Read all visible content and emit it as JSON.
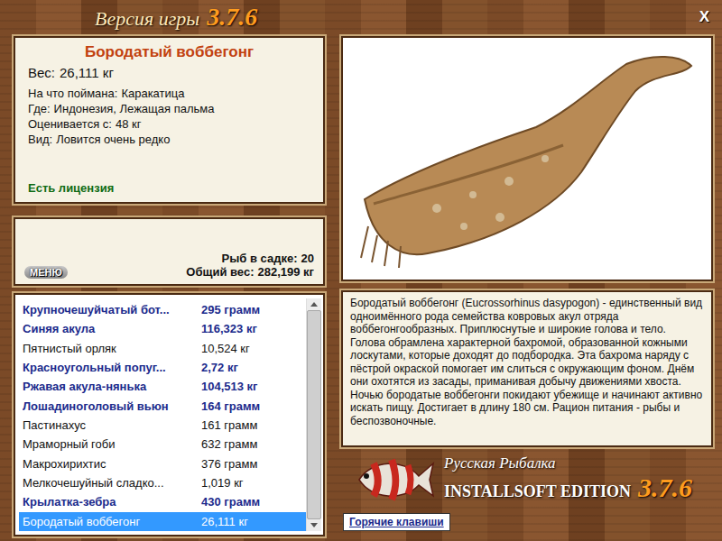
{
  "window": {
    "title": "Версия игры",
    "version": "3.7.6",
    "close": "X"
  },
  "fish_card": {
    "name": "Бородатый воббегонг",
    "weight_label": "Вес:",
    "weight": "26,111 кг",
    "details": [
      {
        "label": "На что поймана:",
        "value": "Каракатица"
      },
      {
        "label": "Где:",
        "value": "Индонезия, Лежащая пальма"
      },
      {
        "label": "Оценивается с:",
        "value": "48 кг"
      },
      {
        "label": "Вид:",
        "value": "Ловится очень редко"
      }
    ],
    "license": "Есть лицензия"
  },
  "keepnet": {
    "menu_button": "МЕНЮ",
    "count_label": "Рыб в садке:",
    "count": "20",
    "total_label": "Общий вес:",
    "total": "282,199 кг"
  },
  "catch_list": {
    "rows": [
      {
        "name": "Крупночешуйчатый бот...",
        "weight": "295 грамм",
        "highlighted": true,
        "selected": false
      },
      {
        "name": "Синяя акула",
        "weight": "116,323 кг",
        "highlighted": true,
        "selected": false
      },
      {
        "name": "Пятнистый орляк",
        "weight": "10,524 кг",
        "highlighted": false,
        "selected": false
      },
      {
        "name": "Красноугольный попуг...",
        "weight": "2,72 кг",
        "highlighted": true,
        "selected": false
      },
      {
        "name": "Ржавая акула-нянька",
        "weight": "104,513 кг",
        "highlighted": true,
        "selected": false
      },
      {
        "name": "Лошадиноголовый вьюн",
        "weight": "164 грамм",
        "highlighted": true,
        "selected": false
      },
      {
        "name": "Пастинахус",
        "weight": "161 грамм",
        "highlighted": false,
        "selected": false
      },
      {
        "name": "Мраморный гоби",
        "weight": "632 грамм",
        "highlighted": false,
        "selected": false
      },
      {
        "name": "Макрохирихтис",
        "weight": "376 грамм",
        "highlighted": false,
        "selected": false
      },
      {
        "name": "Мелкочешуйный сладко...",
        "weight": "1,019 кг",
        "highlighted": false,
        "selected": false
      },
      {
        "name": "Крылатка-зебра",
        "weight": "430 грамм",
        "highlighted": true,
        "selected": false
      },
      {
        "name": "Бородатый воббегонг",
        "weight": "26,111 кг",
        "highlighted": false,
        "selected": true
      }
    ],
    "scrollbar": {
      "level": 1
    }
  },
  "description": "Бородатый воббегонг (Eucrossorhinus dasypogon) - единственный вид одноимённого рода семейства ковровых акул отряда воббегонгообразных. Приплюснутые и широкие голова и тело. Голова обрамлена характерной бахромой, образованной кожными лоскутами, которые доходят до подбородка. Эта бахрома наряду с пёстрой окраской помогает им слиться с окружающим фоном. Днём они охотятся из засады, приманивая добычу движениями хвоста. Ночью бородатые воббегонги покидают убежище и начинают активно искать пищу. Достигает в длину 180 см. Рацион питания - рыбы и беспозвоночные.",
  "logo": {
    "title": "Русская Рыбалка",
    "edition": "INSTALLSOFT EDITION",
    "version": "3.7.6"
  },
  "hotkeys_button": "Горячие клавиши"
}
